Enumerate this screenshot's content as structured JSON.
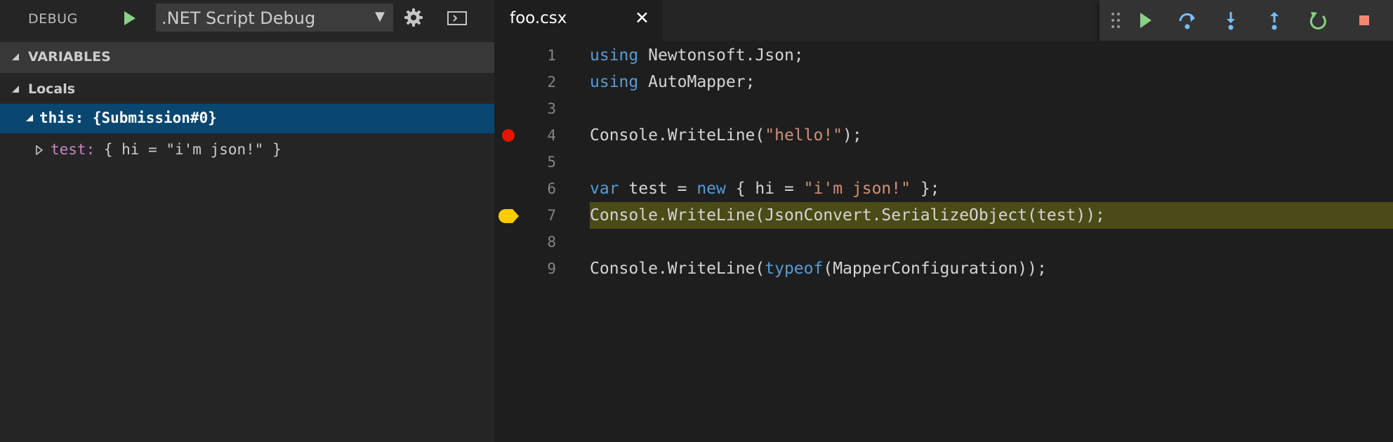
{
  "debug_bar": {
    "label": "DEBUG",
    "configuration": ".NET Script Debug"
  },
  "variables": {
    "section_title": "VARIABLES",
    "scope": "Locals",
    "items": [
      {
        "text": "this: {Submission#0}"
      },
      {
        "name": "test:",
        "value": " { hi = \"i'm json!\" }"
      }
    ]
  },
  "tab": {
    "title": "foo.csx",
    "close": "✕"
  },
  "debug_toolbar": {
    "icons": [
      "drag-handle-icon",
      "continue-icon",
      "step-over-icon",
      "step-into-icon",
      "step-out-icon",
      "restart-icon",
      "stop-icon"
    ]
  },
  "code": {
    "line_numbers": [
      "1",
      "2",
      "3",
      "4",
      "5",
      "6",
      "7",
      "8",
      "9"
    ],
    "lines": [
      [
        {
          "t": "using",
          "c": "kw"
        },
        {
          "t": " Newtonsoft.Json;"
        }
      ],
      [
        {
          "t": "using",
          "c": "kw"
        },
        {
          "t": " AutoMapper;"
        }
      ],
      [],
      [
        {
          "t": "Console.WriteLine("
        },
        {
          "t": "\"hello!\"",
          "c": "str"
        },
        {
          "t": ");"
        }
      ],
      [],
      [
        {
          "t": "var",
          "c": "kw"
        },
        {
          "t": " test = "
        },
        {
          "t": "new",
          "c": "kw"
        },
        {
          "t": " { hi = "
        },
        {
          "t": "\"i'm json!\"",
          "c": "str"
        },
        {
          "t": " };"
        }
      ],
      [
        {
          "t": "Console.WriteLine(JsonConvert.SerializeObject(test));"
        }
      ],
      [],
      [
        {
          "t": "Console.WriteLine("
        },
        {
          "t": "typeof",
          "c": "kw"
        },
        {
          "t": "(MapperConfiguration));"
        }
      ]
    ],
    "breakpoint_line": 4,
    "current_line": 7
  },
  "colors": {
    "keyword": "#569cd6",
    "string": "#ce9178",
    "selection": "#094771",
    "current_line_bg": "#4b4b18",
    "breakpoint": "#e51400",
    "current_marker": "#ffcc00"
  }
}
